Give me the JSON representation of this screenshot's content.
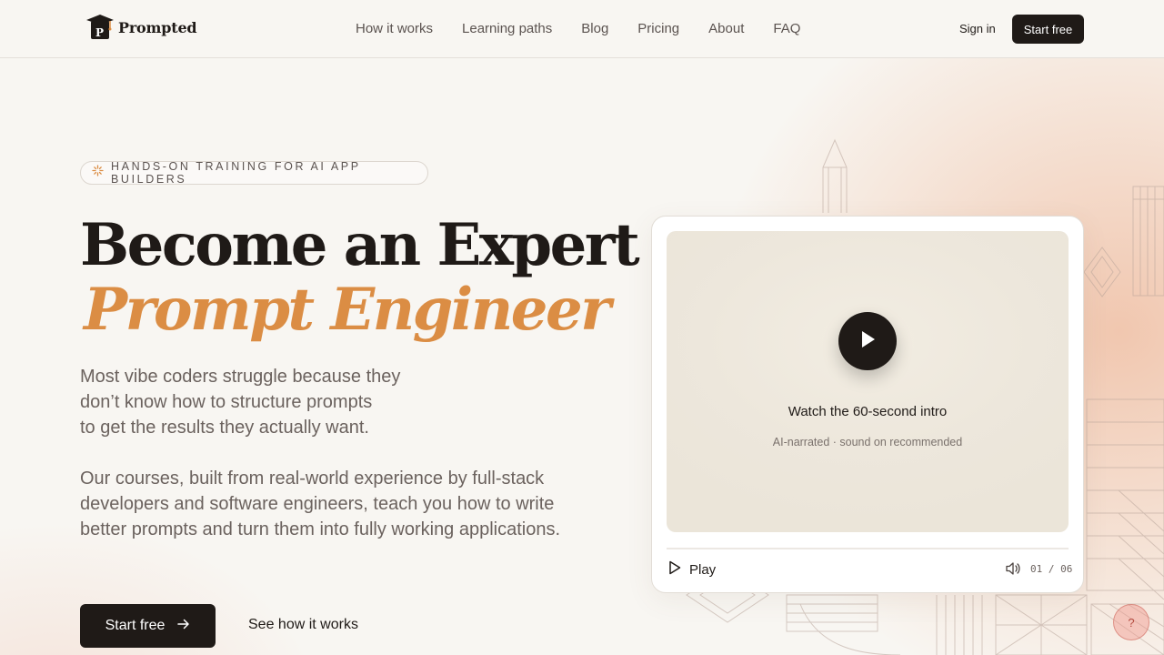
{
  "brand": {
    "name": "Prompted",
    "logo_letter": "P"
  },
  "nav": {
    "links": [
      "How it works",
      "Learning paths",
      "Blog",
      "Pricing",
      "About",
      "FAQ"
    ],
    "sign_in": "Sign in",
    "start_free": "Start free"
  },
  "hero": {
    "eyebrow": "HANDS-ON TRAINING FOR AI APP BUILDERS",
    "title_line1": "Become an Expert",
    "title_line2": "Prompt Engineer",
    "paragraph1": "Most vibe coders struggle because they\ndon’t know how to structure prompts\nto get the results they actually want.",
    "paragraph2": "Our courses, built from real-world experience by full-stack developers and software engineers, teach you how to write better prompts and turn them into fully working applications.",
    "cta_primary": "Start free",
    "cta_secondary": "See how it works"
  },
  "video": {
    "title": "Watch the 60-second intro",
    "subtitle": "AI-narrated · sound on recommended",
    "play_label": "Play",
    "counter": "01 / 06",
    "progress": 0
  },
  "help": {
    "label": "?"
  },
  "colors": {
    "accent": "#db8d44",
    "dark": "#1f1a17",
    "muted": "#6b625e",
    "background": "#f8f6f2"
  },
  "icons": [
    "sparkle-icon",
    "arrow-right-icon",
    "play-icon",
    "volume-icon",
    "graduation-cap-icon"
  ]
}
